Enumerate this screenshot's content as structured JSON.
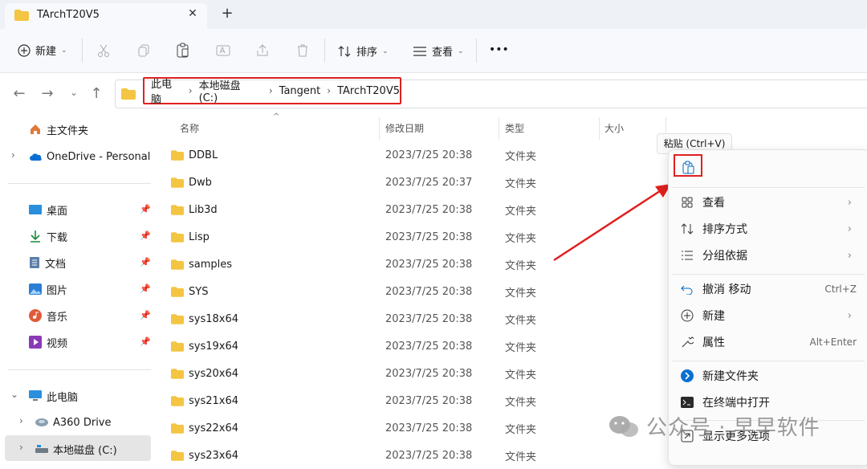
{
  "window": {
    "tab_title": "TArchT20V5",
    "close_glyph": "✕",
    "new_tab_glyph": "+"
  },
  "toolbar": {
    "new_label": "新建",
    "sort_label": "排序",
    "view_label": "查看",
    "more_glyph": "•••"
  },
  "breadcrumb": [
    "此电脑",
    "本地磁盘 (C:)",
    "Tangent",
    "TArchT20V5"
  ],
  "sidebar": {
    "home": "主文件夹",
    "onedrive": "OneDrive - Personal",
    "quick": [
      "桌面",
      "下载",
      "文档",
      "图片",
      "音乐",
      "视频"
    ],
    "thispc": "此电脑",
    "a360": "A360 Drive",
    "localdisk": "本地磁盘 (C:)"
  },
  "columns": {
    "name": "名称",
    "modified": "修改日期",
    "type": "类型",
    "size": "大小"
  },
  "files": [
    {
      "name": "DDBL",
      "date": "2023/7/25 20:38",
      "type": "文件夹"
    },
    {
      "name": "Dwb",
      "date": "2023/7/25 20:37",
      "type": "文件夹"
    },
    {
      "name": "Lib3d",
      "date": "2023/7/25 20:38",
      "type": "文件夹"
    },
    {
      "name": "Lisp",
      "date": "2023/7/25 20:38",
      "type": "文件夹"
    },
    {
      "name": "samples",
      "date": "2023/7/25 20:38",
      "type": "文件夹"
    },
    {
      "name": "SYS",
      "date": "2023/7/25 20:38",
      "type": "文件夹"
    },
    {
      "name": "sys18x64",
      "date": "2023/7/25 20:38",
      "type": "文件夹"
    },
    {
      "name": "sys19x64",
      "date": "2023/7/25 20:38",
      "type": "文件夹"
    },
    {
      "name": "sys20x64",
      "date": "2023/7/25 20:38",
      "type": "文件夹"
    },
    {
      "name": "sys21x64",
      "date": "2023/7/25 20:38",
      "type": "文件夹"
    },
    {
      "name": "sys22x64",
      "date": "2023/7/25 20:38",
      "type": "文件夹"
    },
    {
      "name": "sys23x64",
      "date": "2023/7/25 20:38",
      "type": "文件夹"
    }
  ],
  "context_menu": {
    "tooltip": "粘贴 (Ctrl+V)",
    "view": "查看",
    "sort_by": "排序方式",
    "group_by": "分组依据",
    "undo": "撤消 移动",
    "undo_shortcut": "Ctrl+Z",
    "new": "新建",
    "properties": "属性",
    "properties_shortcut": "Alt+Enter",
    "new_folder": "新建文件夹",
    "open_terminal": "在终端中打开",
    "more_options": "显示更多选项"
  },
  "watermark": "公众号 · 早早软件",
  "colors": {
    "annotation_red": "#e02020",
    "folder_yellow": "#f4c542",
    "accent_blue": "#0067c0"
  }
}
